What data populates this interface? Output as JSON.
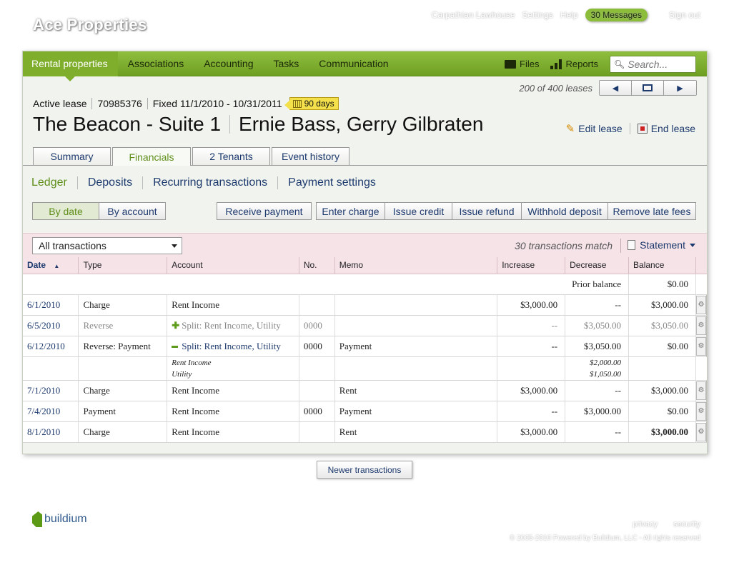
{
  "brand": "Ace Properties",
  "top_links": {
    "user": "Carpathian Lawhouse",
    "settings": "Settings",
    "help": "Help",
    "messages": "30 Messages",
    "signout": "Sign out"
  },
  "nav": {
    "items": [
      "Rental properties",
      "Associations",
      "Accounting",
      "Tasks",
      "Communication"
    ],
    "files": "Files",
    "reports": "Reports",
    "search_placeholder": "Search..."
  },
  "lease_count": "200 of 400 leases",
  "lease": {
    "status": "Active lease",
    "number": "70985376",
    "term": "Fixed 11/1/2010 - 10/31/2011",
    "days_badge": "90 days",
    "property": "The Beacon - Suite 1",
    "tenants": "Ernie Bass, Gerry Gilbraten",
    "edit_label": "Edit lease",
    "end_label": "End lease"
  },
  "tabs": [
    "Summary",
    "Financials",
    "2 Tenants",
    "Event history"
  ],
  "subtabs": [
    "Ledger",
    "Deposits",
    "Recurring transactions",
    "Payment settings"
  ],
  "view_toggle": [
    "By date",
    "By account"
  ],
  "actions": {
    "receive": "Receive payment",
    "group": [
      "Enter charge",
      "Issue credit",
      "Issue refund",
      "Withhold deposit",
      "Remove late fees"
    ]
  },
  "filter": {
    "selected": "All transactions",
    "match_text": "30 transactions match",
    "statement": "Statement"
  },
  "table": {
    "headers": [
      "Date",
      "Type",
      "Account",
      "No.",
      "Memo",
      "Increase",
      "Decrease",
      "Balance"
    ],
    "prior_label": "Prior balance",
    "prior_value": "$0.00",
    "rows": [
      {
        "date": "6/1/2010",
        "type": "Charge",
        "account": "Rent Income",
        "no": "",
        "memo": "",
        "increase": "$3,000.00",
        "decrease": "--",
        "balance": "$3,000.00"
      },
      {
        "date": "6/5/2010",
        "type": "Reverse",
        "account": "Split: Rent Income, Utility",
        "no": "0000",
        "memo": "",
        "increase": "--",
        "decrease": "$3,050.00",
        "balance": "$3,050.00"
      },
      {
        "date": "6/12/2010",
        "type": "Reverse: Payment",
        "account": "Split: Rent Income, Utility",
        "no": "0000",
        "memo": "Payment",
        "increase": "--",
        "decrease": "$3,050.00",
        "balance": "$0.00"
      },
      {
        "date": "7/1/2010",
        "type": "Charge",
        "account": "Rent Income",
        "no": "",
        "memo": "Rent",
        "increase": "$3,000.00",
        "decrease": "--",
        "balance": "$3,000.00"
      },
      {
        "date": "7/4/2010",
        "type": "Payment",
        "account": "Rent Income",
        "no": "0000",
        "memo": "Payment",
        "increase": "--",
        "decrease": "$3,000.00",
        "balance": "$0.00"
      },
      {
        "date": "8/1/2010",
        "type": "Charge",
        "account": "Rent Income",
        "no": "",
        "memo": "Rent",
        "increase": "$3,000.00",
        "decrease": "--",
        "balance": "$3,000.00"
      }
    ],
    "split_detail": {
      "accounts": [
        "Rent Income",
        "Utility"
      ],
      "amounts": [
        "$2,000.00",
        "$1,050.00"
      ]
    }
  },
  "newer_button": "Newer transactions",
  "footer": {
    "logo": "buildium",
    "links": [
      "privacy",
      "security"
    ],
    "copyright": "© 2005-2010 Powered by Buildium, LLC - All rights reserved"
  }
}
